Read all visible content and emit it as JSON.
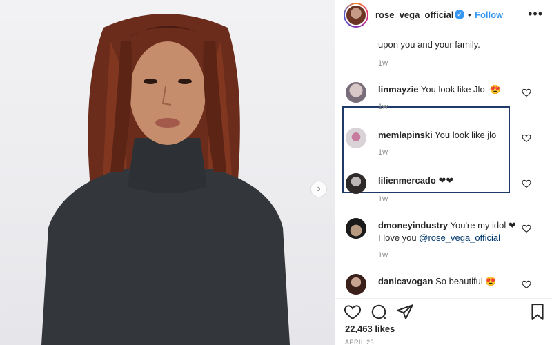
{
  "post": {
    "username": "rose_vega_official",
    "verified_mark": "✓",
    "separator": "•",
    "follow_label": "Follow",
    "more_label": "•••",
    "next_arrow": "›"
  },
  "comments": [
    {
      "user": "",
      "text": "upon you and your family.",
      "time": "1w"
    },
    {
      "user": "linmayzie",
      "text": "You look like Jlo. 😍",
      "time": "1w"
    },
    {
      "user": "memlapinski",
      "text": "You look like jlo",
      "time": "1w"
    },
    {
      "user": "lilienmercado",
      "text": "❤❤",
      "time": "1w"
    },
    {
      "user": "dmoneyindustry",
      "text": "You're my idol ❤ I love you",
      "mention": "@rose_vega_official",
      "time": "1w"
    },
    {
      "user": "danicavogan",
      "text": "So beautiful 😍",
      "time": ""
    }
  ],
  "footer": {
    "likes": "22,463 likes",
    "date": "APRIL 23"
  },
  "colors": {
    "accent": "#3897f0",
    "highlight_border": "#1f3a68",
    "muted": "#8e8e8e"
  },
  "icons": [
    "heart-icon",
    "comment-icon",
    "share-icon",
    "bookmark-icon",
    "more-icon",
    "chevron-right-icon",
    "verified-icon"
  ]
}
